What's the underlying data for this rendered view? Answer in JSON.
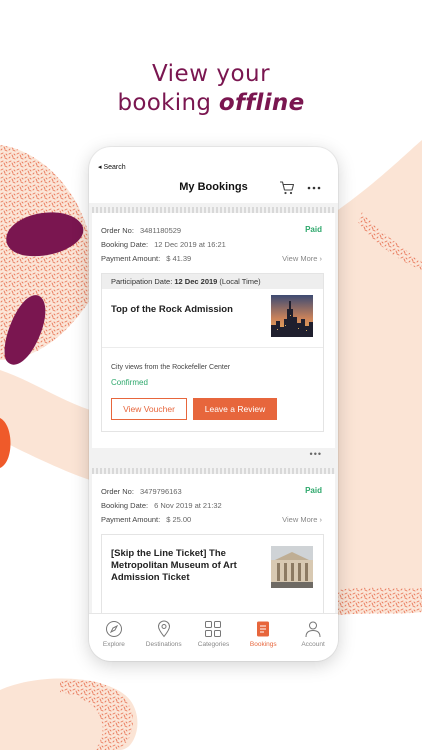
{
  "promo": {
    "headline_line1": "View your",
    "headline_prefix": "booking ",
    "headline_emphasis": "offline"
  },
  "status_bar": {
    "back_label": "◂ Search"
  },
  "header": {
    "title": "My Bookings",
    "cart_icon": "cart-icon",
    "more_icon": "more-icon"
  },
  "orders": [
    {
      "order_label": "Order No:",
      "order_no": "3481180529",
      "status": "Paid",
      "booking_label": "Booking Date:",
      "booking_date": "12 Dec 2019 at 16:21",
      "payment_label": "Payment Amount:",
      "payment_amount": "$ 41.39",
      "view_more": "View More ›",
      "participation_prefix": "Participation Date: ",
      "participation_date": "12 Dec 2019",
      "participation_suffix": " (Local Time)",
      "ticket_name": "Top of the Rock Admission",
      "ticket_desc": "City views from the Rockefeller Center",
      "ticket_status": "Confirmed",
      "view_voucher": "View Voucher",
      "leave_review": "Leave a Review",
      "more_dots": "•••"
    },
    {
      "order_label": "Order No:",
      "order_no": "3479796163",
      "status": "Paid",
      "booking_label": "Booking Date:",
      "booking_date": "6 Nov 2019 at 21:32",
      "payment_label": "Payment Amount:",
      "payment_amount": "$ 25.00",
      "view_more": "View More ›",
      "ticket_name_line1": "[Skip the Line Ticket] The",
      "ticket_name_line2": "Metropolitan Museum of Art",
      "ticket_name_line3": "Admission Ticket"
    }
  ],
  "tabbar": [
    {
      "label": "Explore",
      "icon": "compass-icon",
      "active": false
    },
    {
      "label": "Destinations",
      "icon": "map-pin-icon",
      "active": false
    },
    {
      "label": "Categories",
      "icon": "grid-icon",
      "active": false
    },
    {
      "label": "Bookings",
      "icon": "bookings-icon",
      "active": true
    },
    {
      "label": "Account",
      "icon": "user-icon",
      "active": false
    }
  ],
  "colors": {
    "brand_purple": "#7a1650",
    "accent_orange": "#e7663c",
    "paid_green": "#2ea86c",
    "peach": "#fbe4d5"
  }
}
